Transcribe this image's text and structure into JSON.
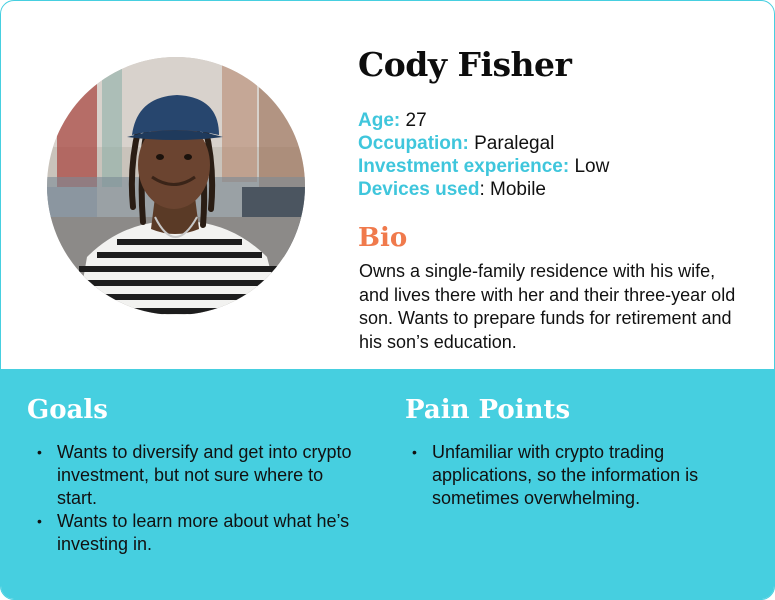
{
  "profile": {
    "name": "Cody Fisher",
    "facts": [
      {
        "label": "Age:",
        "value": " 27"
      },
      {
        "label": "Occupation:",
        "value": " Paralegal"
      },
      {
        "label": "Investment experience:",
        "value": " Low"
      },
      {
        "label": "Devices used",
        "value": ": Mobile"
      }
    ]
  },
  "bio": {
    "title": "Bio",
    "text": "Owns a single-family residence with his wife, and lives there with her and their three-year old son. Wants to prepare funds for retirement and his son’s education."
  },
  "goals": {
    "title": "Goals",
    "items": [
      "Wants to diversify and get into crypto investment, but not sure where to start.",
      "Wants to learn more about what he’s investing in."
    ]
  },
  "pain_points": {
    "title": "Pain Points",
    "items": [
      "Unfamiliar with crypto trading applications, so the information is sometimes overwhelming."
    ]
  },
  "colors": {
    "accent": "#46cfe0",
    "label": "#3fc6dc",
    "bio_title": "#f07a4c"
  },
  "bullet": "•"
}
